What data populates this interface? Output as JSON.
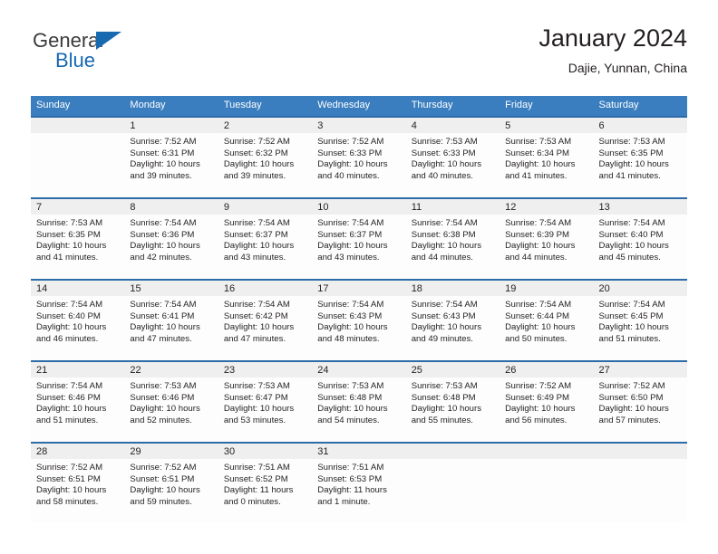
{
  "brand": {
    "name_part1": "General",
    "name_part2": "Blue",
    "triangle_color": "#1769b0"
  },
  "header": {
    "title": "January 2024",
    "subtitle": "Dajie, Yunnan, China"
  },
  "colors": {
    "header_blue": "#3a7ebf",
    "row_divider_blue": "#2d6ca8",
    "day_band_gray": "#efefef",
    "text": "#231f20"
  },
  "weekdays": [
    "Sunday",
    "Monday",
    "Tuesday",
    "Wednesday",
    "Thursday",
    "Friday",
    "Saturday"
  ],
  "weeks": [
    [
      {
        "day": "",
        "sunrise": "",
        "sunset": "",
        "daylight1": "",
        "daylight2": ""
      },
      {
        "day": "1",
        "sunrise": "Sunrise: 7:52 AM",
        "sunset": "Sunset: 6:31 PM",
        "daylight1": "Daylight: 10 hours",
        "daylight2": "and 39 minutes."
      },
      {
        "day": "2",
        "sunrise": "Sunrise: 7:52 AM",
        "sunset": "Sunset: 6:32 PM",
        "daylight1": "Daylight: 10 hours",
        "daylight2": "and 39 minutes."
      },
      {
        "day": "3",
        "sunrise": "Sunrise: 7:52 AM",
        "sunset": "Sunset: 6:33 PM",
        "daylight1": "Daylight: 10 hours",
        "daylight2": "and 40 minutes."
      },
      {
        "day": "4",
        "sunrise": "Sunrise: 7:53 AM",
        "sunset": "Sunset: 6:33 PM",
        "daylight1": "Daylight: 10 hours",
        "daylight2": "and 40 minutes."
      },
      {
        "day": "5",
        "sunrise": "Sunrise: 7:53 AM",
        "sunset": "Sunset: 6:34 PM",
        "daylight1": "Daylight: 10 hours",
        "daylight2": "and 41 minutes."
      },
      {
        "day": "6",
        "sunrise": "Sunrise: 7:53 AM",
        "sunset": "Sunset: 6:35 PM",
        "daylight1": "Daylight: 10 hours",
        "daylight2": "and 41 minutes."
      }
    ],
    [
      {
        "day": "7",
        "sunrise": "Sunrise: 7:53 AM",
        "sunset": "Sunset: 6:35 PM",
        "daylight1": "Daylight: 10 hours",
        "daylight2": "and 41 minutes."
      },
      {
        "day": "8",
        "sunrise": "Sunrise: 7:54 AM",
        "sunset": "Sunset: 6:36 PM",
        "daylight1": "Daylight: 10 hours",
        "daylight2": "and 42 minutes."
      },
      {
        "day": "9",
        "sunrise": "Sunrise: 7:54 AM",
        "sunset": "Sunset: 6:37 PM",
        "daylight1": "Daylight: 10 hours",
        "daylight2": "and 43 minutes."
      },
      {
        "day": "10",
        "sunrise": "Sunrise: 7:54 AM",
        "sunset": "Sunset: 6:37 PM",
        "daylight1": "Daylight: 10 hours",
        "daylight2": "and 43 minutes."
      },
      {
        "day": "11",
        "sunrise": "Sunrise: 7:54 AM",
        "sunset": "Sunset: 6:38 PM",
        "daylight1": "Daylight: 10 hours",
        "daylight2": "and 44 minutes."
      },
      {
        "day": "12",
        "sunrise": "Sunrise: 7:54 AM",
        "sunset": "Sunset: 6:39 PM",
        "daylight1": "Daylight: 10 hours",
        "daylight2": "and 44 minutes."
      },
      {
        "day": "13",
        "sunrise": "Sunrise: 7:54 AM",
        "sunset": "Sunset: 6:40 PM",
        "daylight1": "Daylight: 10 hours",
        "daylight2": "and 45 minutes."
      }
    ],
    [
      {
        "day": "14",
        "sunrise": "Sunrise: 7:54 AM",
        "sunset": "Sunset: 6:40 PM",
        "daylight1": "Daylight: 10 hours",
        "daylight2": "and 46 minutes."
      },
      {
        "day": "15",
        "sunrise": "Sunrise: 7:54 AM",
        "sunset": "Sunset: 6:41 PM",
        "daylight1": "Daylight: 10 hours",
        "daylight2": "and 47 minutes."
      },
      {
        "day": "16",
        "sunrise": "Sunrise: 7:54 AM",
        "sunset": "Sunset: 6:42 PM",
        "daylight1": "Daylight: 10 hours",
        "daylight2": "and 47 minutes."
      },
      {
        "day": "17",
        "sunrise": "Sunrise: 7:54 AM",
        "sunset": "Sunset: 6:43 PM",
        "daylight1": "Daylight: 10 hours",
        "daylight2": "and 48 minutes."
      },
      {
        "day": "18",
        "sunrise": "Sunrise: 7:54 AM",
        "sunset": "Sunset: 6:43 PM",
        "daylight1": "Daylight: 10 hours",
        "daylight2": "and 49 minutes."
      },
      {
        "day": "19",
        "sunrise": "Sunrise: 7:54 AM",
        "sunset": "Sunset: 6:44 PM",
        "daylight1": "Daylight: 10 hours",
        "daylight2": "and 50 minutes."
      },
      {
        "day": "20",
        "sunrise": "Sunrise: 7:54 AM",
        "sunset": "Sunset: 6:45 PM",
        "daylight1": "Daylight: 10 hours",
        "daylight2": "and 51 minutes."
      }
    ],
    [
      {
        "day": "21",
        "sunrise": "Sunrise: 7:54 AM",
        "sunset": "Sunset: 6:46 PM",
        "daylight1": "Daylight: 10 hours",
        "daylight2": "and 51 minutes."
      },
      {
        "day": "22",
        "sunrise": "Sunrise: 7:53 AM",
        "sunset": "Sunset: 6:46 PM",
        "daylight1": "Daylight: 10 hours",
        "daylight2": "and 52 minutes."
      },
      {
        "day": "23",
        "sunrise": "Sunrise: 7:53 AM",
        "sunset": "Sunset: 6:47 PM",
        "daylight1": "Daylight: 10 hours",
        "daylight2": "and 53 minutes."
      },
      {
        "day": "24",
        "sunrise": "Sunrise: 7:53 AM",
        "sunset": "Sunset: 6:48 PM",
        "daylight1": "Daylight: 10 hours",
        "daylight2": "and 54 minutes."
      },
      {
        "day": "25",
        "sunrise": "Sunrise: 7:53 AM",
        "sunset": "Sunset: 6:48 PM",
        "daylight1": "Daylight: 10 hours",
        "daylight2": "and 55 minutes."
      },
      {
        "day": "26",
        "sunrise": "Sunrise: 7:52 AM",
        "sunset": "Sunset: 6:49 PM",
        "daylight1": "Daylight: 10 hours",
        "daylight2": "and 56 minutes."
      },
      {
        "day": "27",
        "sunrise": "Sunrise: 7:52 AM",
        "sunset": "Sunset: 6:50 PM",
        "daylight1": "Daylight: 10 hours",
        "daylight2": "and 57 minutes."
      }
    ],
    [
      {
        "day": "28",
        "sunrise": "Sunrise: 7:52 AM",
        "sunset": "Sunset: 6:51 PM",
        "daylight1": "Daylight: 10 hours",
        "daylight2": "and 58 minutes."
      },
      {
        "day": "29",
        "sunrise": "Sunrise: 7:52 AM",
        "sunset": "Sunset: 6:51 PM",
        "daylight1": "Daylight: 10 hours",
        "daylight2": "and 59 minutes."
      },
      {
        "day": "30",
        "sunrise": "Sunrise: 7:51 AM",
        "sunset": "Sunset: 6:52 PM",
        "daylight1": "Daylight: 11 hours",
        "daylight2": "and 0 minutes."
      },
      {
        "day": "31",
        "sunrise": "Sunrise: 7:51 AM",
        "sunset": "Sunset: 6:53 PM",
        "daylight1": "Daylight: 11 hours",
        "daylight2": "and 1 minute."
      },
      {
        "day": "",
        "sunrise": "",
        "sunset": "",
        "daylight1": "",
        "daylight2": ""
      },
      {
        "day": "",
        "sunrise": "",
        "sunset": "",
        "daylight1": "",
        "daylight2": ""
      },
      {
        "day": "",
        "sunrise": "",
        "sunset": "",
        "daylight1": "",
        "daylight2": ""
      }
    ]
  ]
}
